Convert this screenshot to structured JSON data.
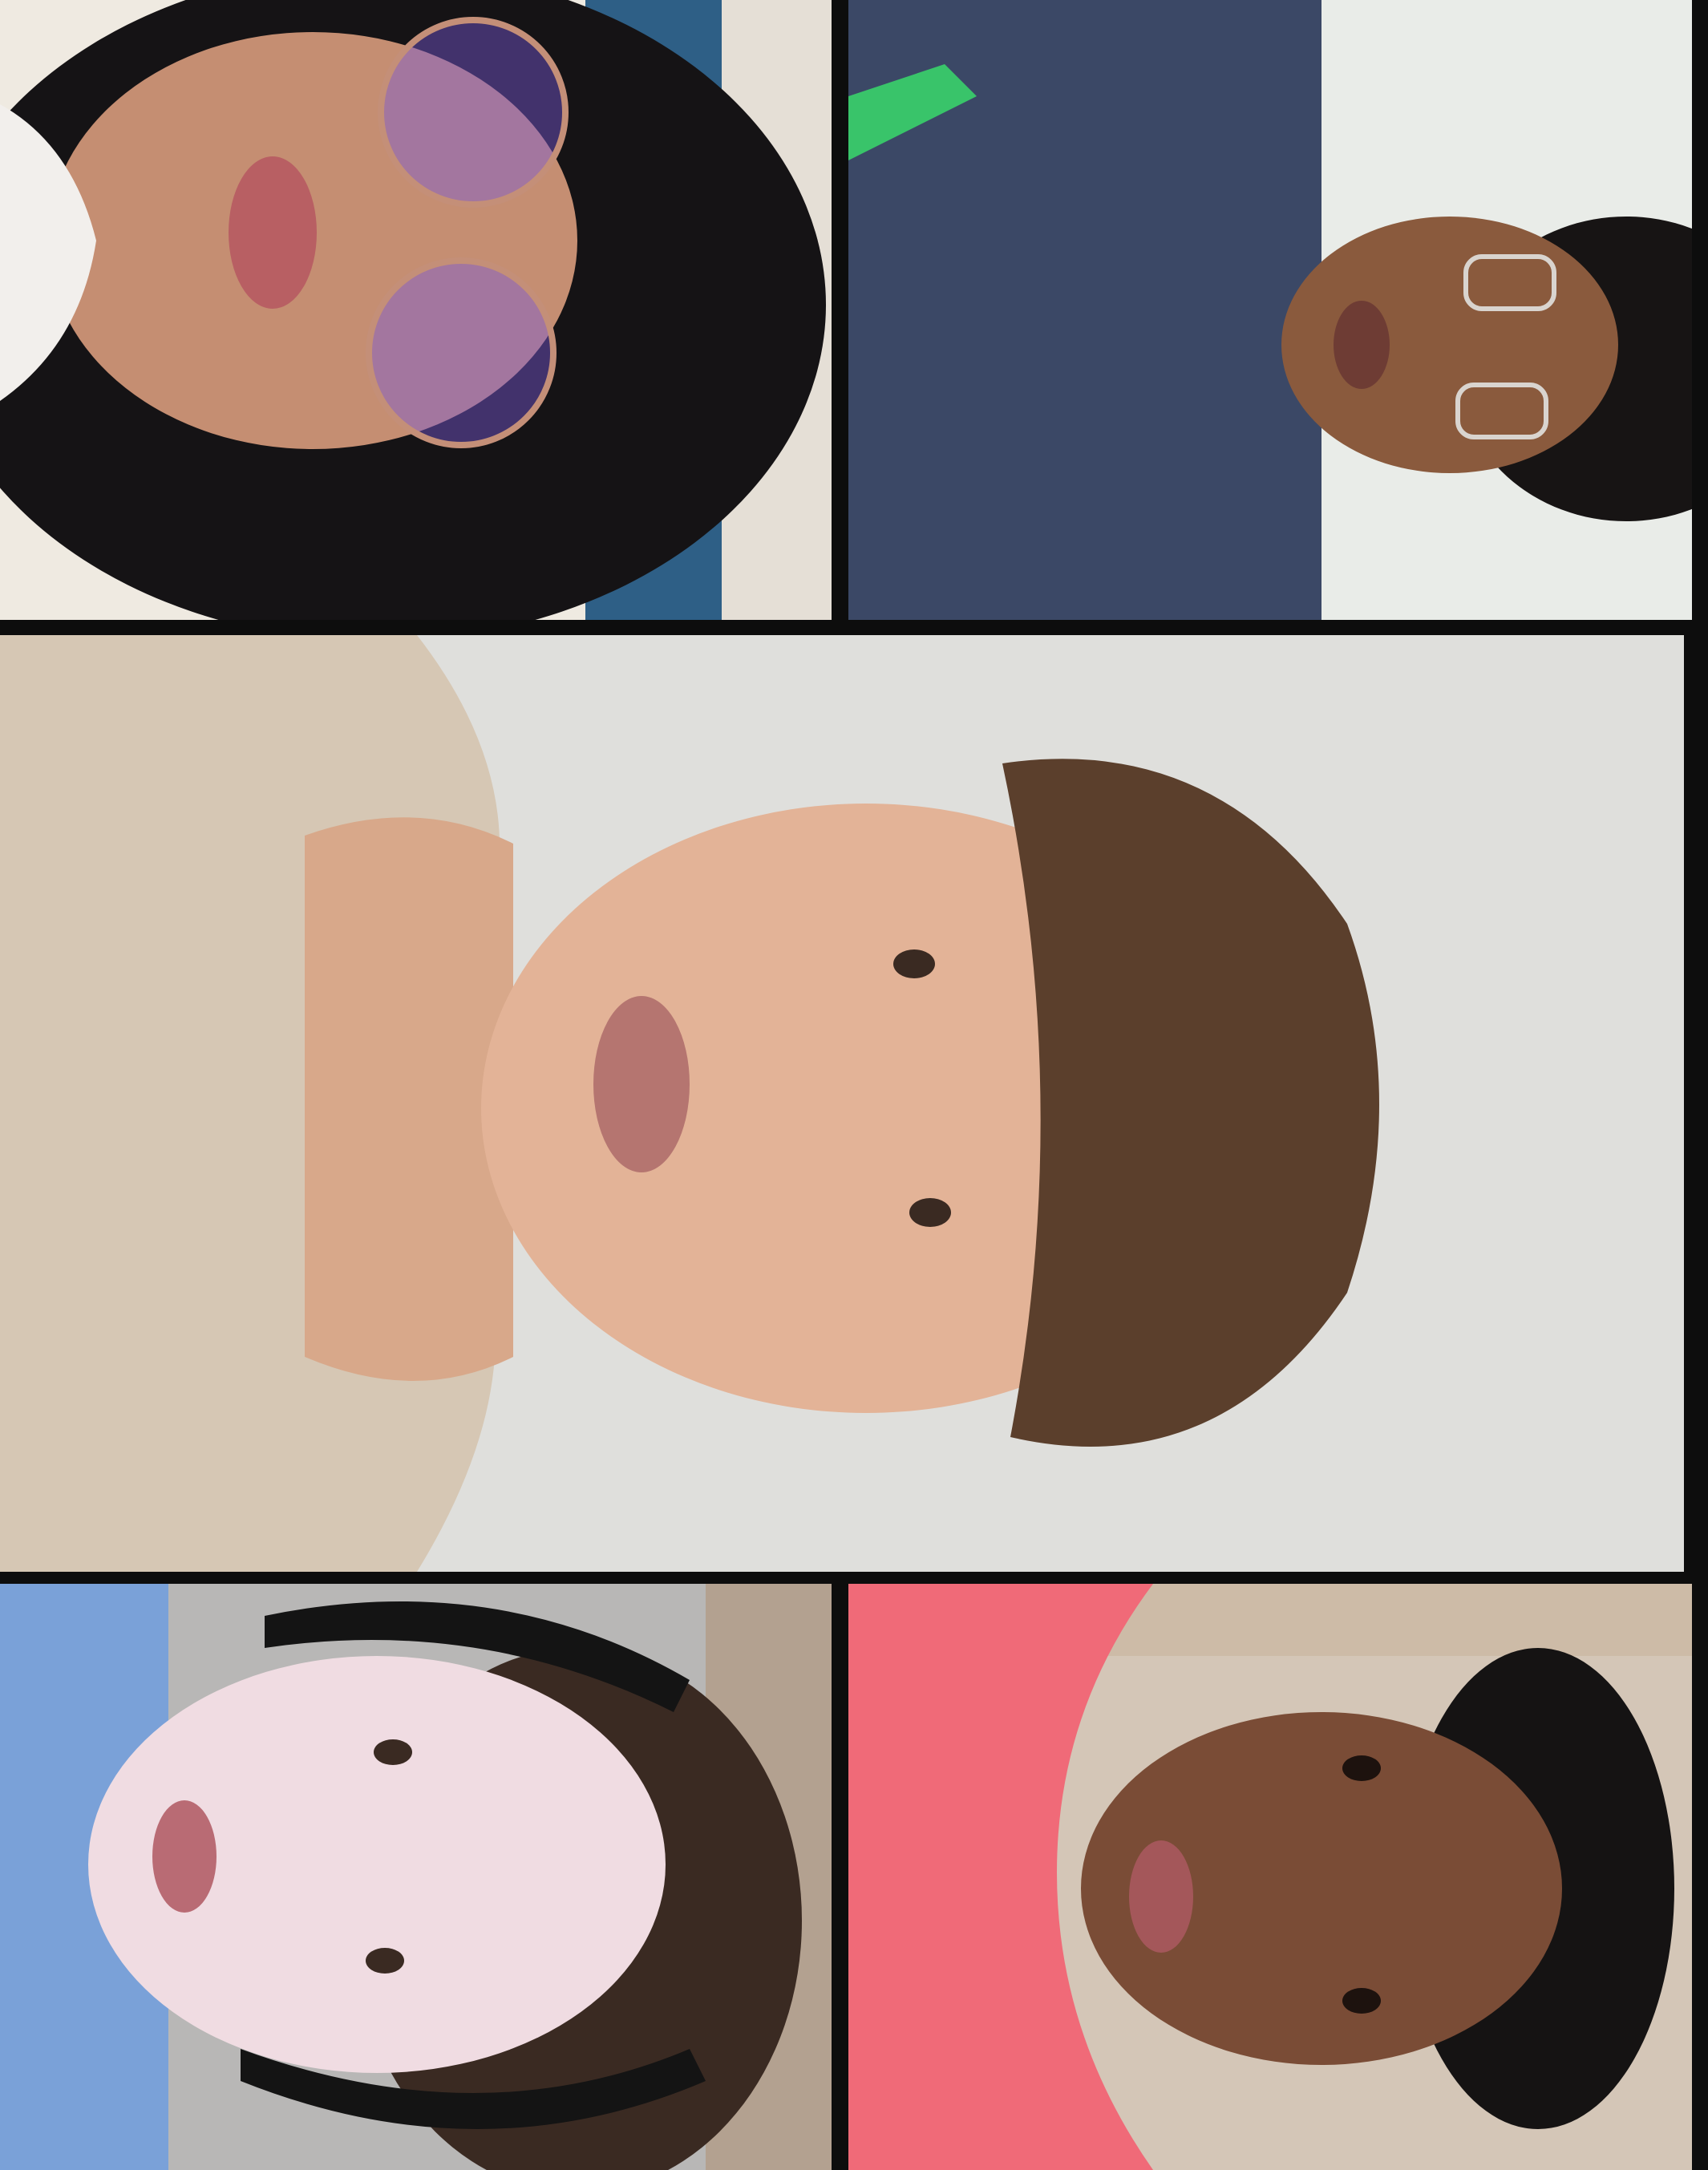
{
  "video_call": {
    "layout": "grid",
    "orientation": "rotated-90",
    "participants": [
      {
        "tile": "top-left",
        "description_icon": "person-glasses-long-hair-icon"
      },
      {
        "tile": "top-right",
        "description_icon": "person-glasses-curly-hair-icon"
      },
      {
        "tile": "center-featured",
        "description_icon": "person-short-hair-icon"
      },
      {
        "tile": "bottom-left",
        "description_icon": "person-headphones-icon"
      },
      {
        "tile": "bottom-right",
        "description_icon": "person-pink-scarf-icon"
      }
    ],
    "colors": {
      "background": "#0d0d0d",
      "wall_light": "#e6e5e2",
      "wall_blue": "#2e5f86",
      "sweater_navy": "#3b4866",
      "sweater_beige": "#d6c7b4",
      "scarf_pink": "#f06a78",
      "shirt_blue": "#7aa1d8"
    }
  }
}
